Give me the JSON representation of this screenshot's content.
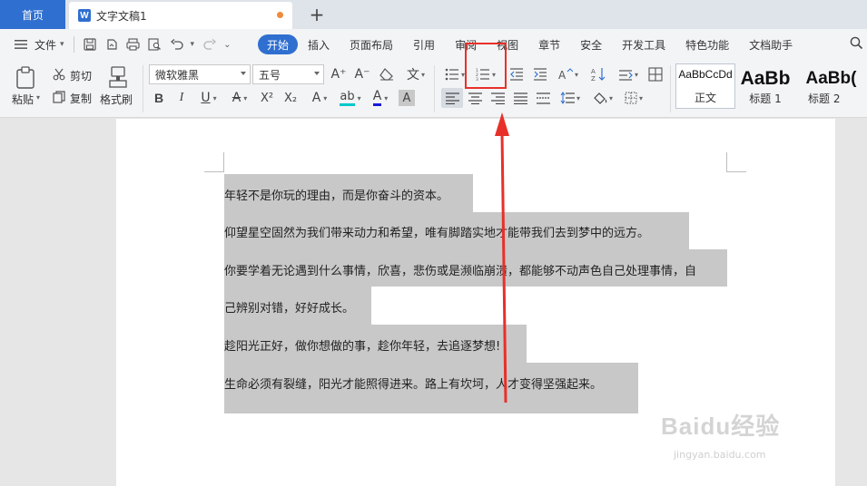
{
  "tabs": {
    "home_label": "首页",
    "doc_icon_letter": "W",
    "doc_title": "文字文稿1",
    "add_symbol": "+"
  },
  "menu": {
    "file_label": "文件",
    "tabs": [
      "开始",
      "插入",
      "页面布局",
      "引用",
      "审阅",
      "视图",
      "章节",
      "安全",
      "开发工具",
      "特色功能",
      "文档助手"
    ],
    "active_tab": "开始"
  },
  "ribbon": {
    "paste_label": "粘贴",
    "cut_label": "剪切",
    "copy_label": "复制",
    "format_painter_label": "格式刷",
    "font_name": "微软雅黑",
    "font_size": "五号",
    "bold": "B",
    "italic": "I",
    "underline": "U",
    "strike": "A",
    "superscript": "X²",
    "subscript": "X₂",
    "font_effects": "A",
    "highlight": "ab",
    "font_color": "A",
    "char_shade": "A",
    "grow_font": "A⁺",
    "shrink_font": "A⁻",
    "phonetic": "文",
    "styles": [
      {
        "sample": "AaBbCcDd",
        "name": "正文"
      },
      {
        "sample": "AaBb",
        "name": "标题 1"
      },
      {
        "sample": "AaBb(",
        "name": "标题 2"
      }
    ]
  },
  "document": {
    "lines": [
      "年轻不是你玩的理由，而是你奋斗的资本。",
      "仰望星空固然为我们带来动力和希望，唯有脚踏实地才能带我们去到梦中的远方。",
      "你要学着无论遇到什么事情，欣喜，悲伤或是濒临崩溃，都能够不动声色自己处理事情，自",
      "己辨别对错，好好成长。",
      "趁阳光正好，做你想做的事，趁你年轻，去追逐梦想!",
      "生命必须有裂缝，阳光才能照得进来。路上有坎坷，人才变得坚强起来。"
    ]
  },
  "watermark": {
    "brand": "Baidu经验",
    "url": "jingyan.baidu.com"
  },
  "colors": {
    "accent": "#2f6fd0",
    "highlight_box": "#e8302a",
    "selection": "#c8c8c8"
  }
}
